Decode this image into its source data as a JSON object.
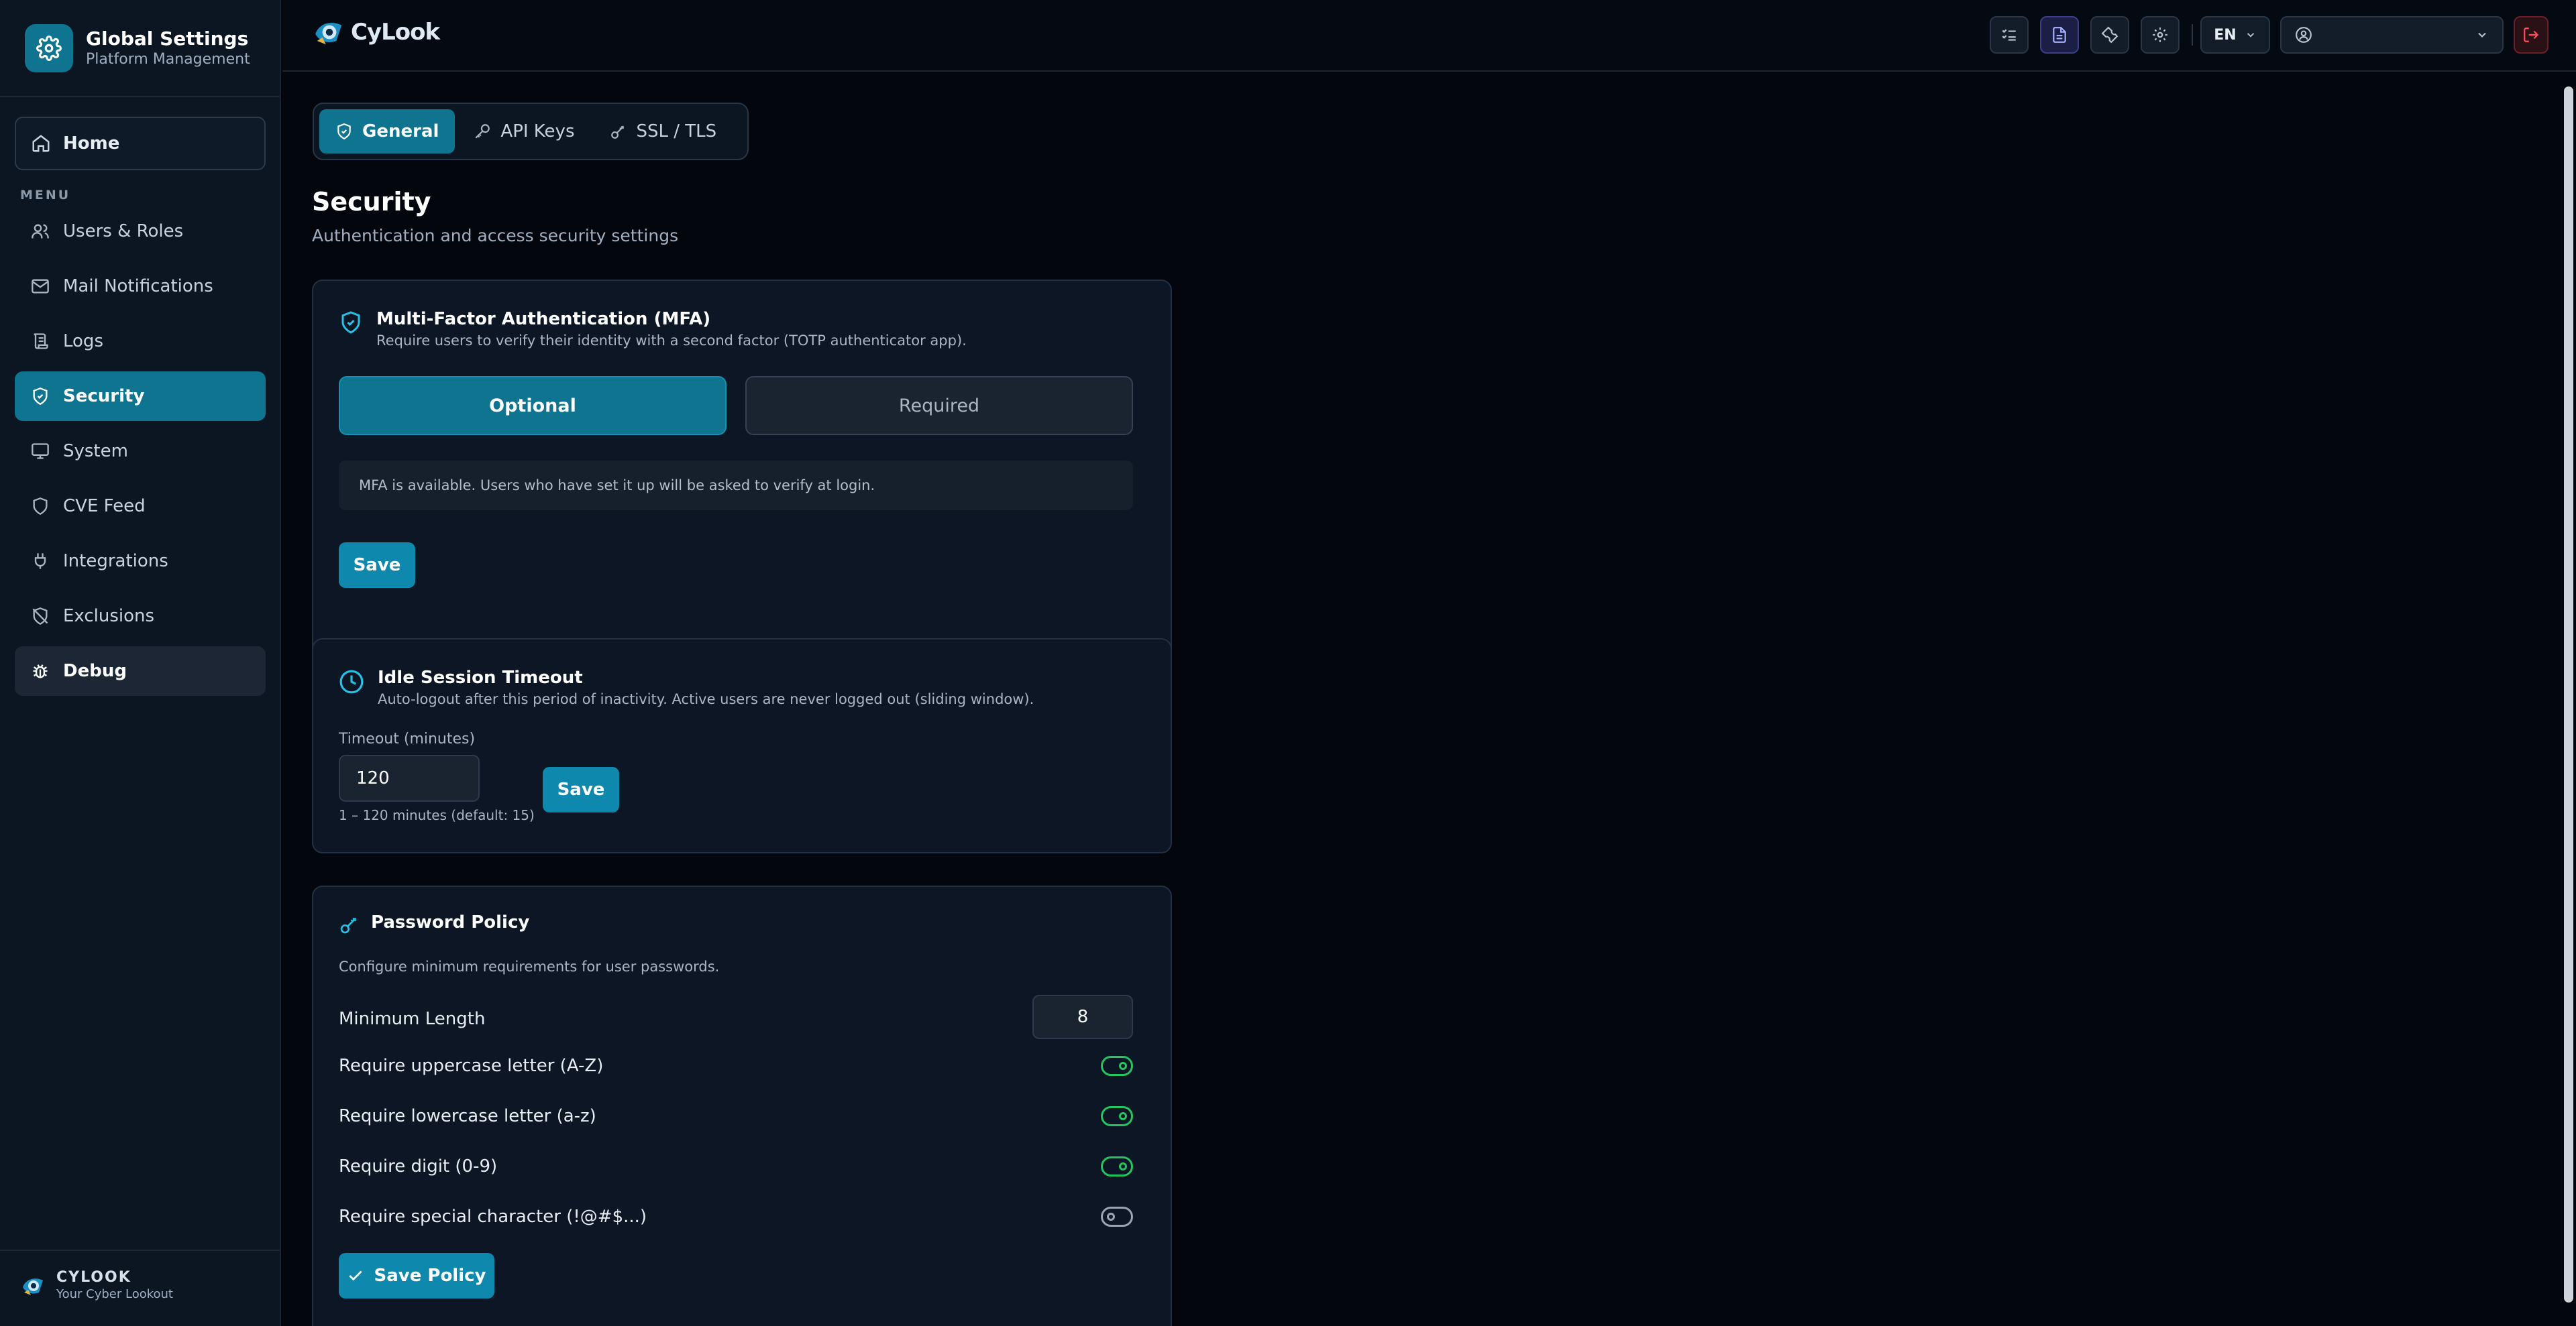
{
  "sidebar": {
    "title": "Global Settings",
    "subtitle": "Platform Management",
    "home": "Home",
    "menu_label": "MENU",
    "items": [
      {
        "label": "Users & Roles",
        "icon": "users-icon"
      },
      {
        "label": "Mail Notifications",
        "icon": "mail-icon"
      },
      {
        "label": "Logs",
        "icon": "scroll-icon"
      },
      {
        "label": "Security",
        "icon": "shield-check-icon",
        "active": true
      },
      {
        "label": "System",
        "icon": "monitor-icon"
      },
      {
        "label": "CVE Feed",
        "icon": "shield-icon"
      },
      {
        "label": "Integrations",
        "icon": "plug-icon"
      },
      {
        "label": "Exclusions",
        "icon": "shield-off-icon"
      },
      {
        "label": "Debug",
        "icon": "bug-icon"
      }
    ],
    "footer": {
      "title": "CYLOOK",
      "subtitle": "Your Cyber Lookout"
    }
  },
  "topbar": {
    "logo_text": "CyLook",
    "language": "EN"
  },
  "tabs": [
    {
      "label": "General",
      "icon": "shield-check-icon",
      "active": true
    },
    {
      "label": "API Keys",
      "icon": "key-icon"
    },
    {
      "label": "SSL / TLS",
      "icon": "key-round-icon"
    }
  ],
  "page": {
    "title": "Security",
    "subtitle": "Authentication and access security settings"
  },
  "mfa": {
    "title": "Multi-Factor Authentication (MFA)",
    "description": "Require users to verify their identity with a second factor (TOTP authenticator app).",
    "option_optional": "Optional",
    "option_required": "Required",
    "selected": "Optional",
    "info": "MFA is available. Users who have set it up will be asked to verify at login.",
    "save": "Save"
  },
  "idle": {
    "title": "Idle Session Timeout",
    "description": "Auto-logout after this period of inactivity. Active users are never logged out (sliding window).",
    "field_label": "Timeout (minutes)",
    "value": "120",
    "hint": "1 – 120 minutes (default: 15)",
    "save": "Save"
  },
  "password": {
    "title": "Password Policy",
    "description": "Configure minimum requirements for user passwords.",
    "min_length_label": "Minimum Length",
    "min_length_value": "8",
    "rules": [
      {
        "label": "Require uppercase letter (A-Z)",
        "enabled": true
      },
      {
        "label": "Require lowercase letter (a-z)",
        "enabled": true
      },
      {
        "label": "Require digit (0-9)",
        "enabled": true
      },
      {
        "label": "Require special character (!@#$...)",
        "enabled": false
      }
    ],
    "save": "Save Policy"
  },
  "colors": {
    "accent": "#0e7490",
    "button": "#0e89ad",
    "toggle_on": "#22c55e",
    "logout": "#ff4d5e"
  }
}
